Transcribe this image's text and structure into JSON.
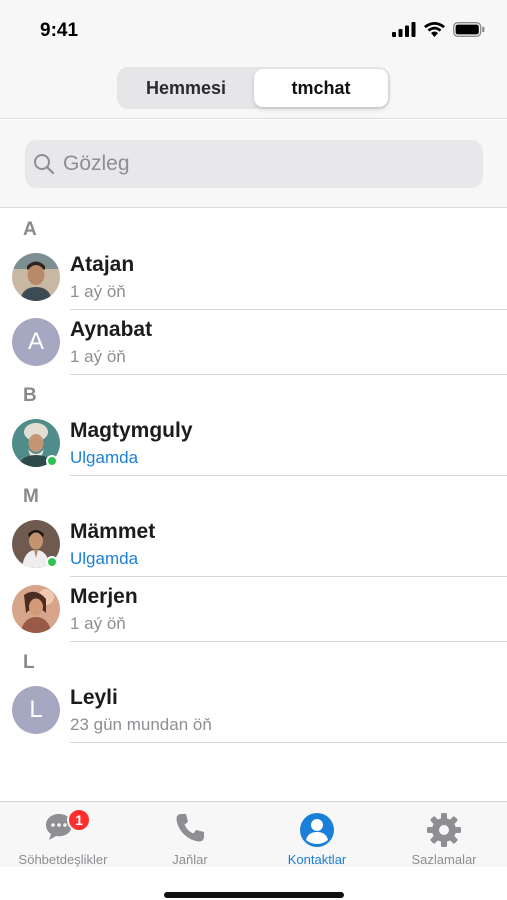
{
  "status": {
    "time": "9:41"
  },
  "segments": {
    "all": "Hemmesi",
    "tmchat": "tmchat",
    "selected": "tmchat"
  },
  "search": {
    "placeholder": "Gözleg",
    "value": ""
  },
  "sections": [
    {
      "letter": "A",
      "contacts": [
        {
          "name": "Atajan",
          "status": "1 aý öň",
          "online": false
        },
        {
          "name": "Aynabat",
          "status": "1 aý öň",
          "online": false,
          "initial": "A"
        }
      ]
    },
    {
      "letter": "B",
      "contacts": [
        {
          "name": "Magtymguly",
          "status": "Ulgamda",
          "online": true
        }
      ]
    },
    {
      "letter": "M",
      "contacts": [
        {
          "name": "Mämmet",
          "status": "Ulgamda",
          "online": true
        },
        {
          "name": "Merjen",
          "status": "1 aý öň",
          "online": false
        }
      ]
    },
    {
      "letter": "L",
      "contacts": [
        {
          "name": "Leyli",
          "status": "23 gün mundan öň",
          "online": false,
          "initial": "L"
        }
      ]
    }
  ],
  "tabs": [
    {
      "label": "Söhbetdeşlikler",
      "icon": "chat-bubbles-icon",
      "badge": "1",
      "active": false
    },
    {
      "label": "Jaňlar",
      "icon": "phone-icon",
      "active": false
    },
    {
      "label": "Kontaktlar",
      "icon": "person-circle-icon",
      "active": true
    },
    {
      "label": "Sazlamalar",
      "icon": "gear-icon",
      "active": false
    }
  ],
  "colors": {
    "accent": "#1a7fd8",
    "online": "#2ec34e",
    "badge": "#ff2d2d",
    "letterAvatar": "#a6a8c2"
  }
}
